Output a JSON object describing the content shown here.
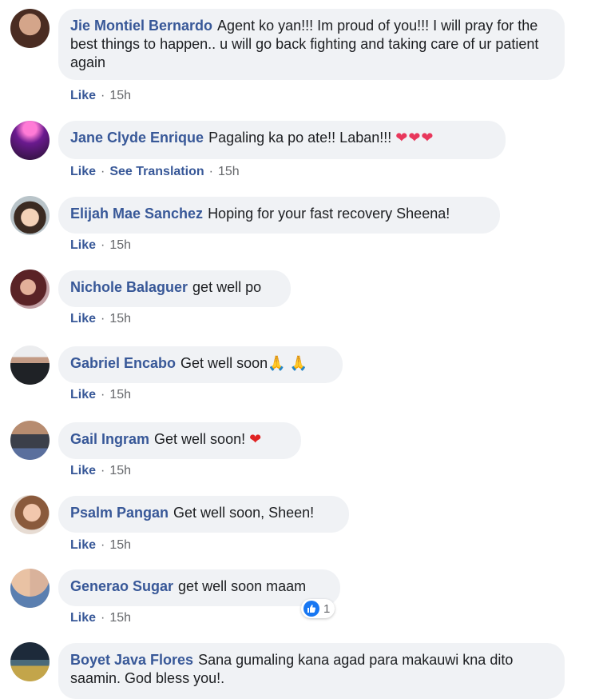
{
  "comments": [
    {
      "author": "Jie Montiel Bernardo",
      "text": "Agent ko yan!!! Im proud of you!!! I will pray for the best things to happen.. u will go back fighting and taking care of ur patient again",
      "like": "Like",
      "time": "15h"
    },
    {
      "author": "Jane Clyde Enrique",
      "text": "Pagaling ka po ate!! Laban!!!",
      "emoji": "❤❤❤",
      "like": "Like",
      "translate": "See Translation",
      "time": "15h"
    },
    {
      "author": "Elijah Mae Sanchez",
      "text": "Hoping for your fast recovery Sheena!",
      "like": "Like",
      "time": "15h"
    },
    {
      "author": "Nichole Balaguer",
      "text": "get well po",
      "like": "Like",
      "time": "15h"
    },
    {
      "author": "Gabriel Encabo",
      "text": "Get well soon",
      "emoji": "🙏 🙏",
      "like": "Like",
      "time": "15h"
    },
    {
      "author": "Gail Ingram",
      "text": "Get well soon!",
      "emoji": "❤",
      "like": "Like",
      "time": "15h"
    },
    {
      "author": "Psalm Pangan",
      "text": "Get well soon, Sheen!",
      "like": "Like",
      "time": "15h"
    },
    {
      "author": "Generao Sugar",
      "text": "get well soon maam",
      "like": "Like",
      "time": "15h",
      "reaction_count": "1"
    },
    {
      "author": "Boyet Java Flores",
      "text": "Sana gumaling kana agad para makauwi kna dito saamin. God bless you!."
    }
  ],
  "colors": {
    "author": "#385898",
    "bubble": "#f0f2f5",
    "meta": "#65676b",
    "like_reaction": "#1877f2"
  },
  "icons": {
    "reaction": "thumbs-up-icon"
  }
}
